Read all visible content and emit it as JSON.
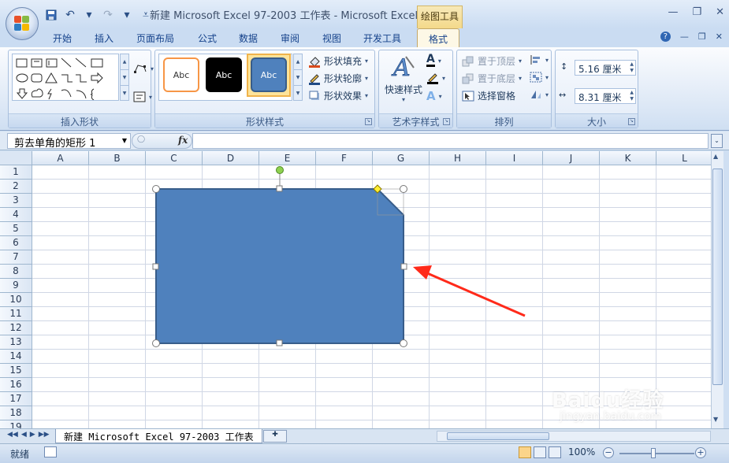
{
  "window": {
    "title": "新建 Microsoft Excel 97-2003 工作表 - Microsoft Excel",
    "context_tab_group": "绘图工具"
  },
  "tabs": [
    "开始",
    "插入",
    "页面布局",
    "公式",
    "数据",
    "审阅",
    "视图",
    "开发工具",
    "格式"
  ],
  "active_tab": "格式",
  "ribbon": {
    "insert_shapes": {
      "label": "插入形状"
    },
    "shape_styles": {
      "label": "形状样式",
      "thumb_text": "Abc",
      "fill": "形状填充",
      "outline": "形状轮廓",
      "effects": "形状效果"
    },
    "wordart": {
      "label": "艺术字样式",
      "quick_styles": "快速样式"
    },
    "arrange": {
      "label": "排列",
      "bring_to_front": "置于顶层",
      "send_to_back": "置于底层",
      "selection_pane": "选择窗格"
    },
    "size": {
      "label": "大小",
      "height": "5.16 厘米",
      "width": "8.31 厘米"
    }
  },
  "formula_bar": {
    "name_box": "剪去单角的矩形 1",
    "fx": "fx",
    "formula": ""
  },
  "grid": {
    "columns": [
      "A",
      "B",
      "C",
      "D",
      "E",
      "F",
      "G",
      "H",
      "I",
      "J",
      "K",
      "L"
    ],
    "rows": [
      "1",
      "2",
      "3",
      "4",
      "5",
      "6",
      "7",
      "8",
      "9",
      "10",
      "11",
      "12",
      "13",
      "14",
      "15",
      "16",
      "17",
      "18",
      "19"
    ]
  },
  "shape": {
    "type": "snip-single-corner-rectangle",
    "fill": "#4f81bd",
    "outline": "#385d8a"
  },
  "annotation_arrow_color": "#ff2a1a",
  "sheet_tabs": [
    "新建 Microsoft Excel 97-2003 工作表"
  ],
  "status": {
    "text": "就绪",
    "zoom": "100%"
  },
  "watermark": {
    "brand": "Baidu经验",
    "url": "jingyan.baidu.com"
  }
}
